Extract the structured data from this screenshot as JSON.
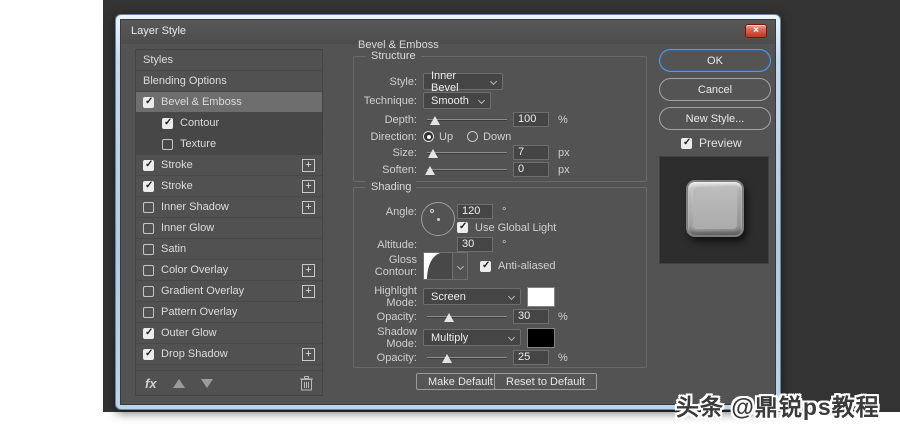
{
  "window": {
    "title": "Layer Style",
    "close_glyph": "×"
  },
  "sidebar": {
    "items": [
      {
        "label": "Styles",
        "checkbox": false,
        "checked": false,
        "plus": false
      },
      {
        "label": "Blending Options",
        "checkbox": false,
        "checked": false,
        "plus": false
      },
      {
        "label": "Bevel & Emboss",
        "checkbox": true,
        "checked": true,
        "plus": false,
        "selected": true
      },
      {
        "label": "Contour",
        "checkbox": true,
        "checked": true,
        "plus": false,
        "sub": true
      },
      {
        "label": "Texture",
        "checkbox": true,
        "checked": false,
        "plus": false,
        "sub": true
      },
      {
        "label": "Stroke",
        "checkbox": true,
        "checked": true,
        "plus": true
      },
      {
        "label": "Stroke",
        "checkbox": true,
        "checked": true,
        "plus": true
      },
      {
        "label": "Inner Shadow",
        "checkbox": true,
        "checked": false,
        "plus": true
      },
      {
        "label": "Inner Glow",
        "checkbox": true,
        "checked": false,
        "plus": false
      },
      {
        "label": "Satin",
        "checkbox": true,
        "checked": false,
        "plus": false
      },
      {
        "label": "Color Overlay",
        "checkbox": true,
        "checked": false,
        "plus": true
      },
      {
        "label": "Gradient Overlay",
        "checkbox": true,
        "checked": false,
        "plus": true
      },
      {
        "label": "Pattern Overlay",
        "checkbox": true,
        "checked": false,
        "plus": false
      },
      {
        "label": "Outer Glow",
        "checkbox": true,
        "checked": true,
        "plus": false
      },
      {
        "label": "Drop Shadow",
        "checkbox": true,
        "checked": true,
        "plus": true
      }
    ],
    "fx_label": "fx"
  },
  "panel": {
    "title": "Bevel & Emboss",
    "structure": {
      "legend": "Structure",
      "style_label": "Style:",
      "style_value": "Inner Bevel",
      "technique_label": "Technique:",
      "technique_value": "Smooth",
      "depth_label": "Depth:",
      "depth_value": "100",
      "depth_unit": "%",
      "direction_label": "Direction:",
      "direction_up": "Up",
      "direction_down": "Down",
      "size_label": "Size:",
      "size_value": "7",
      "size_unit": "px",
      "soften_label": "Soften:",
      "soften_value": "0",
      "soften_unit": "px"
    },
    "shading": {
      "legend": "Shading",
      "angle_label": "Angle:",
      "angle_value": "120",
      "angle_unit": "°",
      "use_global_light_label": "Use Global Light",
      "use_global_light_checked": true,
      "altitude_label": "Altitude:",
      "altitude_value": "30",
      "altitude_unit": "°",
      "gloss_label": "Gloss Contour:",
      "anti_aliased_label": "Anti-aliased",
      "anti_aliased_checked": true,
      "highlight_label": "Highlight Mode:",
      "highlight_value": "Screen",
      "highlight_color": "#ffffff",
      "opacity1_label": "Opacity:",
      "opacity1_value": "30",
      "opacity1_unit": "%",
      "shadow_label": "Shadow Mode:",
      "shadow_value": "Multiply",
      "shadow_color": "#000000",
      "opacity2_label": "Opacity:",
      "opacity2_value": "25",
      "opacity2_unit": "%"
    },
    "footer": {
      "make_default": "Make Default",
      "reset_default": "Reset to Default"
    }
  },
  "actions": {
    "ok": "OK",
    "cancel": "Cancel",
    "new_style": "New Style...",
    "preview_label": "Preview",
    "preview_checked": true
  },
  "watermark": "头条 @鼎锐ps教程",
  "colors": {
    "accent_blue": "#5e9ad8",
    "backdrop": "#333333",
    "dialog_bg": "#535353"
  }
}
